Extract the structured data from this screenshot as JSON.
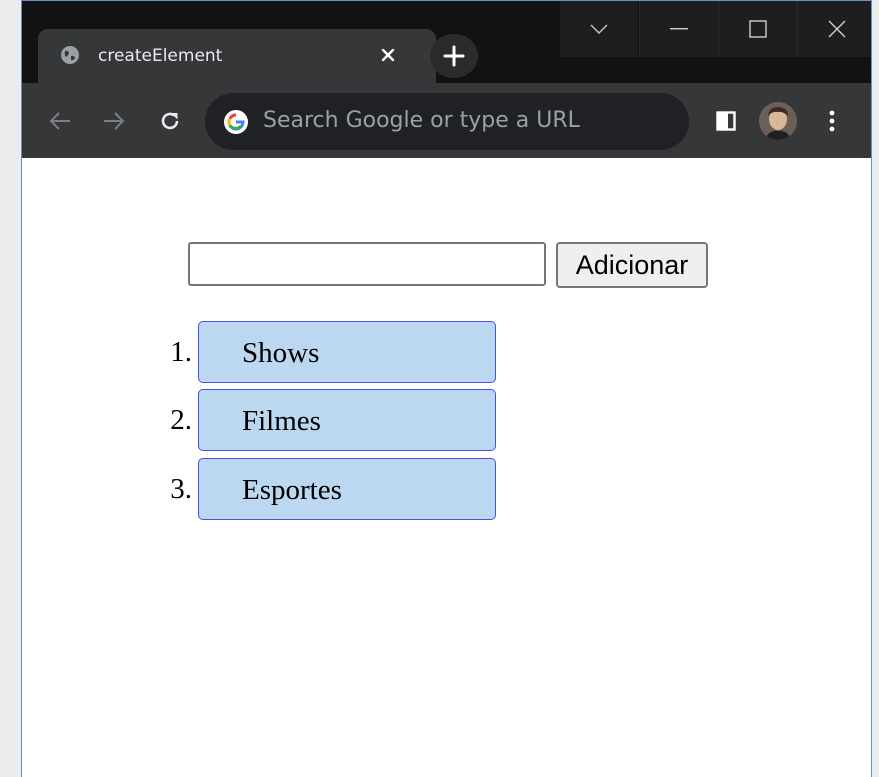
{
  "browser": {
    "tab": {
      "title": "createElement"
    },
    "omnibox": {
      "placeholder": "Search Google or type a URL"
    }
  },
  "page": {
    "input": {
      "value": ""
    },
    "add_button_label": "Adicionar",
    "items": [
      {
        "number": "1.",
        "label": "Shows"
      },
      {
        "number": "2.",
        "label": "Filmes"
      },
      {
        "number": "3.",
        "label": "Esportes"
      }
    ]
  },
  "colors": {
    "item_background": "#bcd8f0",
    "item_border": "#4d4de0",
    "chrome_dark": "#121212",
    "toolbar": "#353739"
  }
}
